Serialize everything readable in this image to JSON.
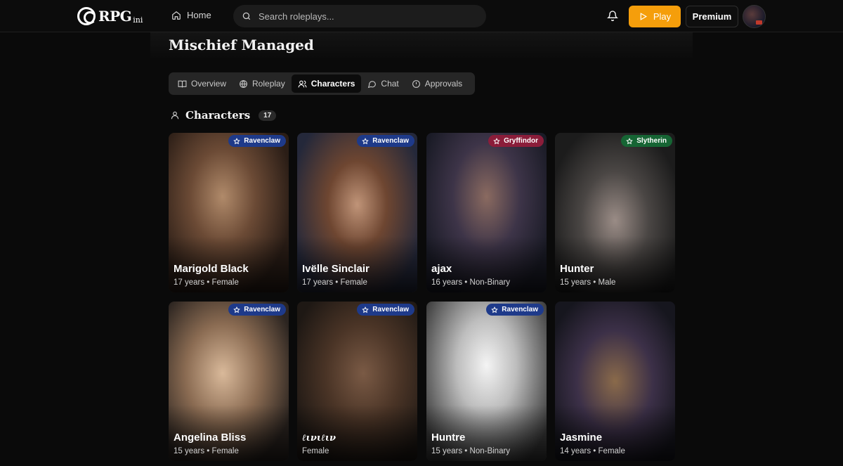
{
  "brand": {
    "logo_text": "RPG",
    "logo_sub": "ini"
  },
  "nav": {
    "home_label": "Home"
  },
  "search": {
    "placeholder": "Search roleplays..."
  },
  "actions": {
    "play_label": "Play",
    "premium_label": "Premium"
  },
  "page": {
    "title": "Mischief Managed"
  },
  "tabs": [
    {
      "label": "Overview",
      "icon": "book-open-icon",
      "active": false
    },
    {
      "label": "Roleplay",
      "icon": "globe-icon",
      "active": false
    },
    {
      "label": "Characters",
      "icon": "users-icon",
      "active": true
    },
    {
      "label": "Chat",
      "icon": "chat-bubble-icon",
      "active": false
    },
    {
      "label": "Approvals",
      "icon": "alert-circle-icon",
      "active": false
    }
  ],
  "section": {
    "title": "Characters",
    "count": "17",
    "icon": "user-icon"
  },
  "colors": {
    "accent": "#f59e0b",
    "ravenclaw": "#1e3a8a",
    "gryffindor": "#8b1d3a",
    "slytherin": "#166534"
  },
  "characters": [
    {
      "name": "Marigold Black",
      "meta": "17 years • Female",
      "house": "Ravenclaw",
      "bg": "radial-gradient(ellipse at 45% 40%, #b08a6a 0%, #6b4a35 35%, #2a1d16 75%)"
    },
    {
      "name": "Ivëlle Sinclair",
      "meta": "17 years • Female",
      "house": "Ravenclaw",
      "bg": "radial-gradient(ellipse at 50% 45%, #c09478 0%, #6e4631 35%, #24283a 80%)"
    },
    {
      "name": "ajax",
      "meta": "16 years • Non-Binary",
      "house": "Gryffindor",
      "bg": "radial-gradient(ellipse at 50% 40%, #8a6a60 0%, #3d3448 40%, #1a1b26 80%)"
    },
    {
      "name": "Hunter",
      "meta": "15 years • Male",
      "house": "Slytherin",
      "bg": "radial-gradient(ellipse at 50% 55%, #9a8c86 0%, #4a4644 40%, #1c1c1c 80%)"
    },
    {
      "name": "Angelina Bliss",
      "meta": "15 years • Female",
      "house": "Ravenclaw",
      "bg": "radial-gradient(ellipse at 45% 45%, #d9b99a 0%, #8a6b52 40%, #2b2420 80%)"
    },
    {
      "name": "ℓινιℓιν",
      "meta": "Female",
      "house": "Ravenclaw",
      "bg": "radial-gradient(ellipse at 55% 45%, #7a5a45 0%, #4a3426 40%, #1e1814 80%)",
      "script": true
    },
    {
      "name": "Huntre",
      "meta": "15 years • Non-Binary",
      "house": "Ravenclaw",
      "bg": "radial-gradient(ellipse at 50% 40%, #f4f4f4 0%, #bdbdbd 35%, #3a3a3a 85%)"
    },
    {
      "name": "Jasmine",
      "meta": "14 years • Female",
      "house": "",
      "bg": "radial-gradient(ellipse at 50% 50%, #8a6a4a 0%, #3c3048 45%, #16161e 85%)"
    }
  ]
}
